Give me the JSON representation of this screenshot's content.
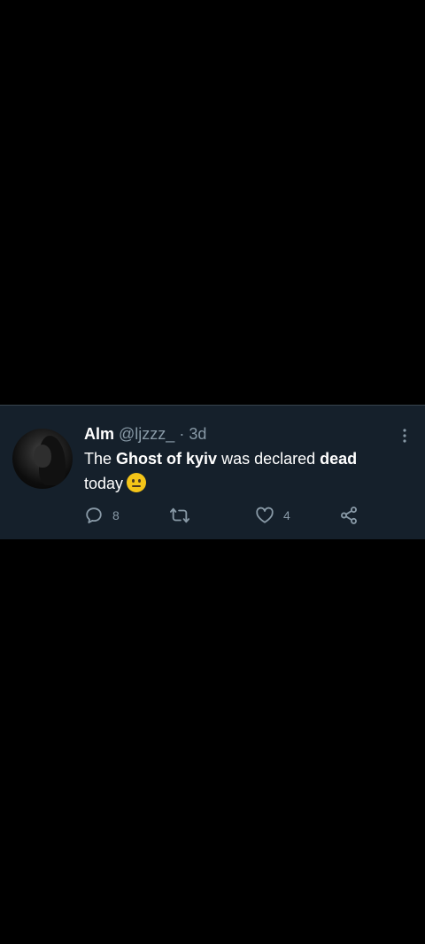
{
  "tweet": {
    "display_name": "Alm",
    "handle": "@ljzzz_",
    "separator": "·",
    "time": "3d",
    "text_parts": {
      "p1": "The ",
      "p2": "Ghost of kyiv",
      "p3": " was declared ",
      "p4": "dead",
      "p5": " today"
    },
    "emoji": "neutral-face-emoji"
  },
  "actions": {
    "reply_count": "8",
    "retweet_count": "",
    "like_count": "4"
  },
  "icons": {
    "more": "more-vertical-icon",
    "reply": "reply-icon",
    "retweet": "retweet-icon",
    "like": "heart-icon",
    "share": "share-icon"
  },
  "colors": {
    "card_background": "#15202b",
    "page_background": "#000000",
    "secondary_text": "#8899a6",
    "primary_text": "#ffffff"
  }
}
